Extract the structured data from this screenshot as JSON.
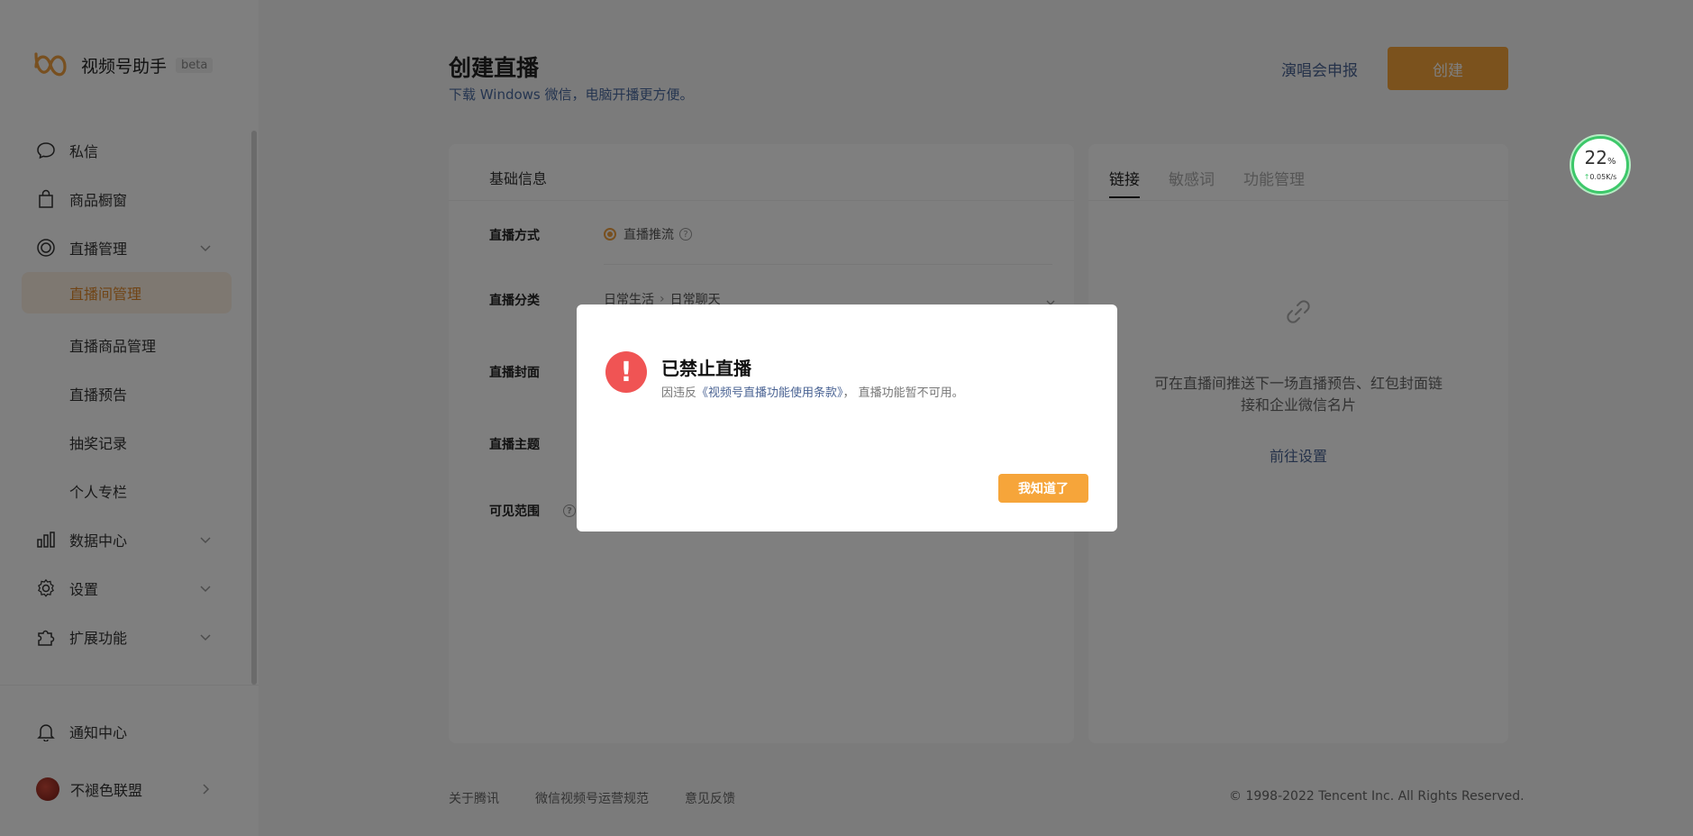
{
  "brand": {
    "name": "视频号助手",
    "badge": "beta",
    "color": "#f6a53a"
  },
  "sidebar": {
    "items": [
      {
        "label": "私信",
        "icon": "message-bubble-icon"
      },
      {
        "label": "商品橱窗",
        "icon": "shopping-bag-icon"
      },
      {
        "label": "直播管理",
        "icon": "live-target-icon",
        "expanded": true
      },
      {
        "label": "数据中心",
        "icon": "bar-chart-icon"
      },
      {
        "label": "设置",
        "icon": "gear-icon"
      },
      {
        "label": "扩展功能",
        "icon": "puzzle-icon"
      }
    ],
    "live_sub": [
      "直播间管理",
      "直播商品管理",
      "直播预告",
      "抽奖记录",
      "个人专栏"
    ],
    "active_sub": "直播间管理",
    "notify": {
      "label": "通知中心",
      "icon": "bell-icon"
    },
    "account": {
      "label": "不褪色联盟"
    }
  },
  "header": {
    "title": "创建直播",
    "subtitle": "下载 Windows 微信，电脑开播更方便。",
    "concert_link": "演唱会申报",
    "create_button": "创建"
  },
  "basic_info": {
    "title": "基础信息",
    "fields": {
      "method_label": "直播方式",
      "method_value": "直播推流",
      "category_label": "直播分类",
      "category_l1": "日常生活",
      "category_l2": "日常聊天",
      "cover_label": "直播封面",
      "topic_label": "直播主题",
      "visibility_label": "可见范围"
    }
  },
  "right_panel": {
    "tabs": [
      "链接",
      "敏感词",
      "功能管理"
    ],
    "active_tab": "链接",
    "desc": "可在直播间推送下一场直播预告、红包封面链接和企业微信名片",
    "action": "前往设置"
  },
  "footer": {
    "links": [
      "关于腾讯",
      "微信视频号运营规范",
      "意见反馈"
    ],
    "copyright": "© 1998-2022 Tencent Inc. All Rights Reserved."
  },
  "speed_widget": {
    "percent": "22",
    "percent_unit": "%",
    "rate": "0.05K/s"
  },
  "dialog": {
    "title": "已禁止直播",
    "msg_prefix": "因违反",
    "msg_terms": "《视频号直播功能使用条款》",
    "msg_suffix": "， 直播功能暂不可用。",
    "ok_button": "我知道了"
  }
}
